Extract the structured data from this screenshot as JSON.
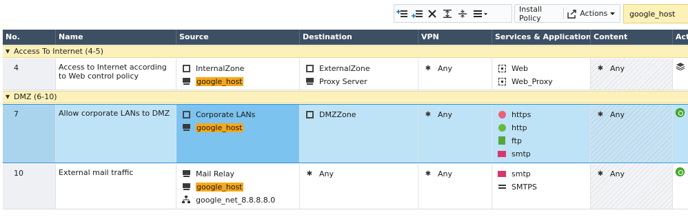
{
  "toolbar": {
    "install_policy": "Install Policy",
    "actions": "Actions",
    "search_value": "google_host"
  },
  "columns": [
    "No.",
    "Name",
    "Source",
    "Destination",
    "VPN",
    "Services & Applications",
    "Content",
    "Act"
  ],
  "sections": [
    {
      "label": "Access To Internet",
      "range": "(4-5)"
    },
    {
      "label": "DMZ",
      "range": "(6-10)"
    }
  ],
  "rules": [
    {
      "no": "4",
      "name": "Access to Internet according to Web control policy",
      "source": [
        {
          "icon": "zone-icon",
          "text": "InternalZone"
        },
        {
          "icon": "host-icon",
          "text": "google_host"
        }
      ],
      "destination": [
        {
          "icon": "zone-icon",
          "text": "ExternalZone"
        },
        {
          "icon": "host-icon",
          "text": "Proxy Server"
        }
      ],
      "vpn": "Any",
      "services": [
        {
          "icon": "service-icon",
          "text": "Web"
        },
        {
          "icon": "service-icon",
          "text": "Web_Proxy"
        }
      ],
      "content": "Any",
      "action": "inline-layer-icon"
    },
    {
      "no": "7",
      "name": "Allow corporate LANs to DMZ",
      "source": [
        {
          "icon": "zone-icon",
          "text": "Corporate LANs"
        },
        {
          "icon": "host-icon",
          "text": "google_host"
        }
      ],
      "destination": [
        {
          "icon": "zone-icon",
          "text": "DMZZone"
        }
      ],
      "vpn": "Any",
      "services": [
        {
          "icon": "https-icon",
          "text": "https"
        },
        {
          "icon": "http-icon",
          "text": "http"
        },
        {
          "icon": "ftp-icon",
          "text": "ftp"
        },
        {
          "icon": "mail-icon",
          "text": "smtp"
        }
      ],
      "content": "Any",
      "action": "accept-icon"
    },
    {
      "no": "10",
      "name": "External mail traffic",
      "source": [
        {
          "icon": "host-icon",
          "text": "Mail Relay"
        },
        {
          "icon": "host-icon",
          "text": "google_host"
        },
        {
          "icon": "network-icon",
          "text": "google_net_8.8.8.8.0"
        }
      ],
      "destination": [
        {
          "icon": "any-icon",
          "text": "Any"
        }
      ],
      "vpn": "Any",
      "services": [
        {
          "icon": "mail-icon",
          "text": "smtp"
        },
        {
          "icon": "smtps-icon",
          "text": "SMTPS"
        }
      ],
      "content": "Any",
      "action": "accept-icon"
    }
  ],
  "colors": {
    "header": "#3d4f63",
    "section": "#fcf1ba",
    "selected_row": "#bfe3f6",
    "highlight": "#f7a81b"
  }
}
